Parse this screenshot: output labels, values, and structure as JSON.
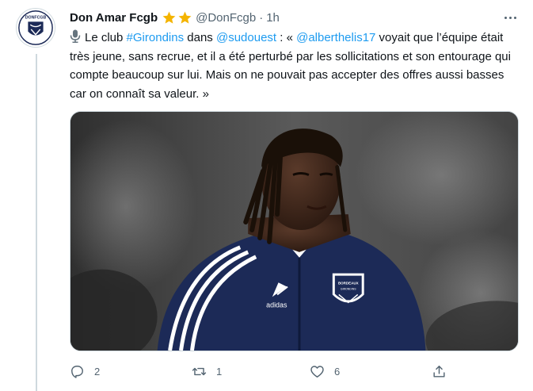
{
  "tweet": {
    "author_name": "Don Amar Fcgb",
    "author_handle": "@DonFcgb",
    "separator": "·",
    "time": "1h",
    "badge_icons": [
      "star-icon",
      "star-icon"
    ],
    "avatar_text": "DONFCGB",
    "text": {
      "intro": "Le club ",
      "hashtag": "#Girondins",
      "mid1": " dans ",
      "mention1": "@sudouest",
      "mid2": " : « ",
      "mention2": "@alberthelis17",
      "rest": " voyait que l’équipe était très jeune, sans recrue, et il a été perturbé par les sollicitations et son entourage qui compte beaucoup sur lui. Mais on ne pouvait pas accepter des offres aussi basses car on connaît sa valeur. »"
    },
    "media": {
      "jersey_brand": "adidas",
      "crest_text": "BORDEAUX",
      "crest_subtext": "GIRONDINS"
    },
    "actions": {
      "reply_count": "2",
      "retweet_count": "1",
      "like_count": "6"
    }
  },
  "colors": {
    "link": "#1d9bf0",
    "secondary_text": "#536471",
    "star": "#f4b400",
    "jersey": "#1c2a57"
  }
}
